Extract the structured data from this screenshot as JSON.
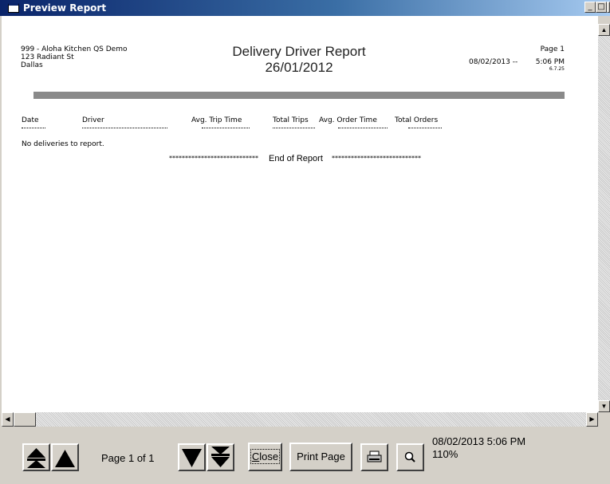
{
  "window": {
    "title": "Preview Report"
  },
  "report": {
    "store_name": "999 - Aloha Kitchen QS Demo",
    "address": "123 Radiant St",
    "city": "Dallas",
    "title": "Delivery Driver Report",
    "report_date": "26/01/2012",
    "page_label": "Page 1",
    "printed_date": "08/02/2013 --",
    "printed_time": "5:06 PM",
    "version": "6.7.25",
    "columns": [
      "Date",
      "Driver",
      "Avg. Trip Time",
      "Total Trips",
      "Avg. Order Time",
      "Total Orders"
    ],
    "empty_message": "No deliveries to report.",
    "end_stars": "****************************",
    "end_label": "End of Report"
  },
  "toolbar": {
    "page_status": "Page 1 of 1",
    "close_label": "Close",
    "close_mnemonic": "C",
    "close_rest": "lose",
    "print_page_label": "Print Page",
    "status_datetime": "08/02/2013  5:06 PM",
    "zoom": "110%"
  },
  "icons": {
    "first_page": "double-up-triangle-icon",
    "prev_page": "up-triangle-icon",
    "next_page": "down-triangle-icon",
    "last_page": "double-down-triangle-icon",
    "print": "printer-icon",
    "zoom": "magnifier-icon"
  }
}
